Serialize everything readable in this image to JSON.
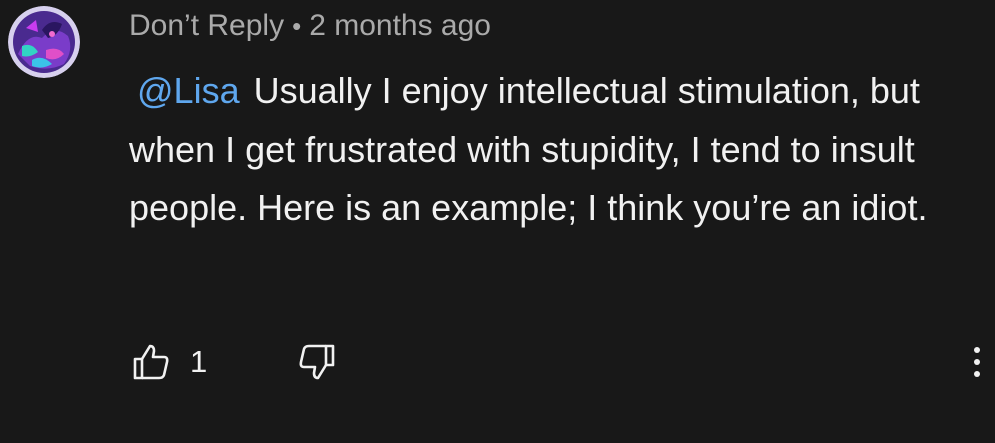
{
  "comment": {
    "author": "Don’t Reply",
    "separator": "•",
    "timestamp": "2 months ago",
    "mention": "@Lisa",
    "text": "Usually I enjoy intellectual stimulation, but when I get frustrated with stupidity, I tend to insult people. Here is an example; I think you’re an idiot.",
    "like_count": "1"
  },
  "icons": {
    "avatar": "avatar-image",
    "like": "thumbs-up-icon",
    "dislike": "thumbs-down-icon",
    "more": "more-vertical-icon"
  },
  "colors": {
    "background": "#181818",
    "text": "#f1f1f1",
    "meta": "#aaaaaa",
    "mention": "#5fa7ee"
  }
}
